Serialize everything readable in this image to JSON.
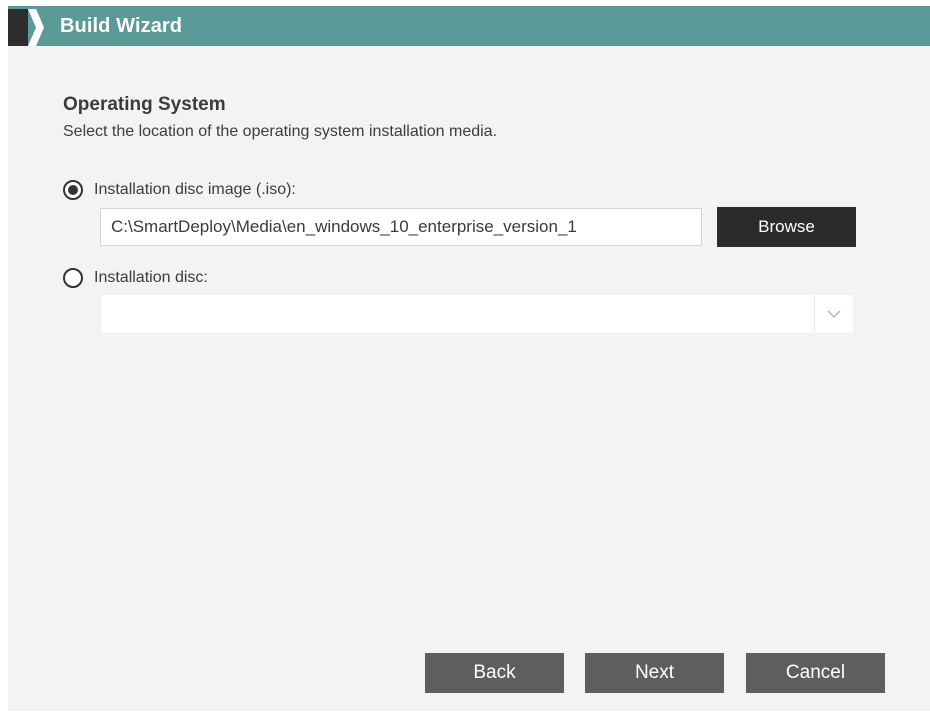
{
  "window": {
    "title": "Build Wizard",
    "logo_icon": "smartdeploy-logo-icon",
    "title_bar_color": "#5a9a97"
  },
  "page": {
    "heading": "Operating System",
    "subheading": "Select the location of the operating system installation media."
  },
  "options": {
    "iso": {
      "label": "Installation disc image (.iso):",
      "selected": true,
      "path_value": "C:\\SmartDeploy\\Media\\en_windows_10_enterprise_version_1",
      "browse_label": "Browse"
    },
    "disc": {
      "label": "Installation disc:",
      "selected": false,
      "selected_value": "",
      "dropdown_icon": "chevron-down-icon"
    }
  },
  "footer": {
    "back_label": "Back",
    "next_label": "Next",
    "cancel_label": "Cancel",
    "button_color": "#5e5e5e"
  }
}
